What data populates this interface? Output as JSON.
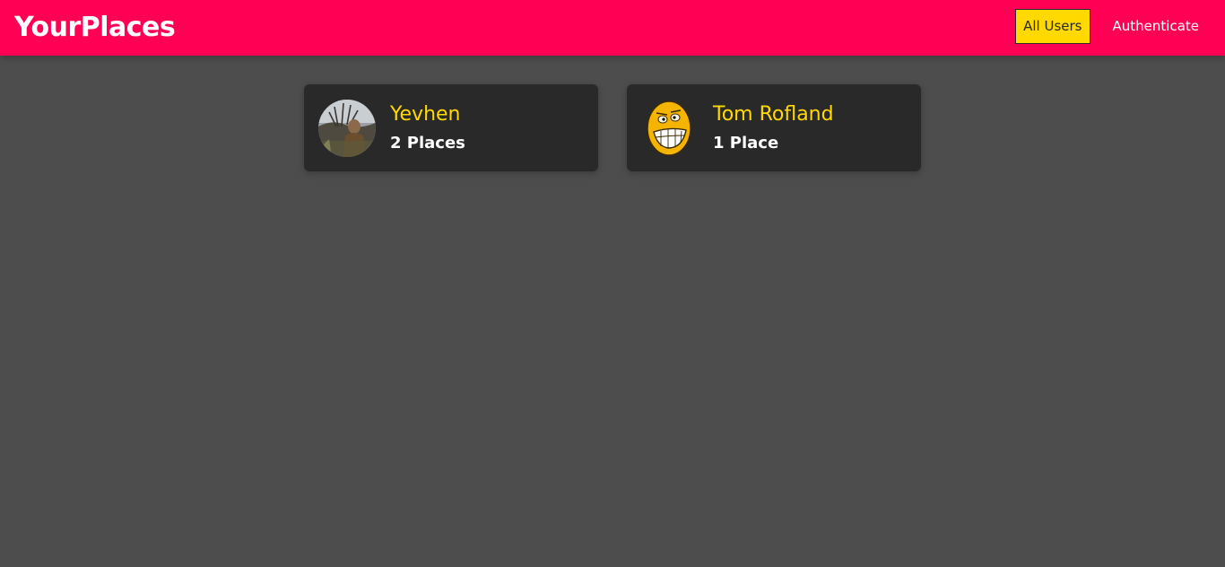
{
  "header": {
    "title": "YourPlaces",
    "nav": [
      {
        "label": "All Users",
        "active": true
      },
      {
        "label": "Authenticate",
        "active": false
      }
    ]
  },
  "users": [
    {
      "name": "Yevhen",
      "places": "2 Places",
      "avatar": "photo-avatar"
    },
    {
      "name": "Tom Rofland",
      "places": "1 Place",
      "avatar": "smiley-face-avatar"
    }
  ],
  "colors": {
    "header_bg": "#ff0055",
    "page_bg": "#4d4d4d",
    "card_bg": "#292929",
    "accent": "#ffd900"
  }
}
